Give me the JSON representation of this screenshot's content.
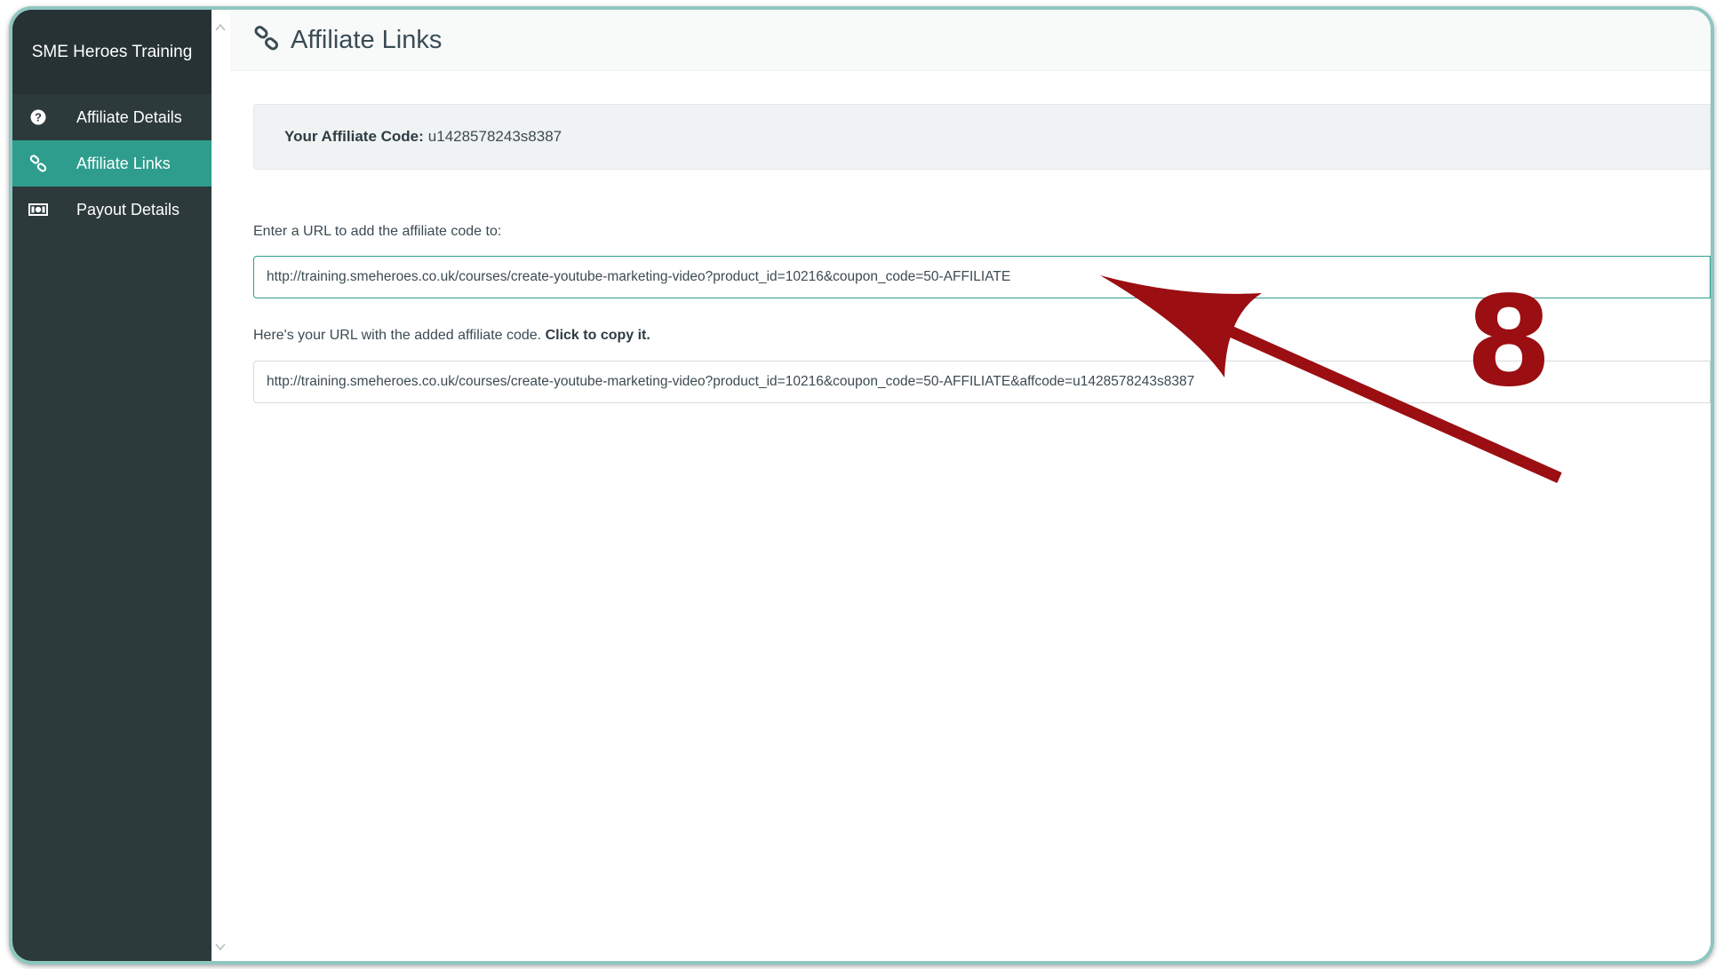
{
  "sidebar": {
    "brand": "SME Heroes Training",
    "items": [
      {
        "label": "Affiliate Details",
        "icon": "question-circle-icon"
      },
      {
        "label": "Affiliate Links",
        "icon": "link-icon",
        "active": true
      },
      {
        "label": "Payout Details",
        "icon": "money-icon"
      }
    ]
  },
  "header": {
    "title": "Affiliate Links",
    "icon": "link-icon"
  },
  "affiliate_code": {
    "label": "Your Affiliate Code:",
    "value": "u1428578243s8387"
  },
  "url_input": {
    "label": "Enter a URL to add the affiliate code to:",
    "value": "http://training.smeheroes.co.uk/courses/create-youtube-marketing-video?product_id=10216&coupon_code=50-AFFILIATE"
  },
  "result": {
    "label": "Here's your URL with the added affiliate code.",
    "label_bold": "Click to copy it.",
    "value": "http://training.smeheroes.co.uk/courses/create-youtube-marketing-video?product_id=10216&coupon_code=50-AFFILIATE&affcode=u1428578243s8387"
  },
  "annotation": {
    "step_number": "8",
    "color": "#9b0e12"
  },
  "colors": {
    "sidebar": "#2c3a3b",
    "accent": "#2e9d8d",
    "frame": "#8ec7c0"
  }
}
